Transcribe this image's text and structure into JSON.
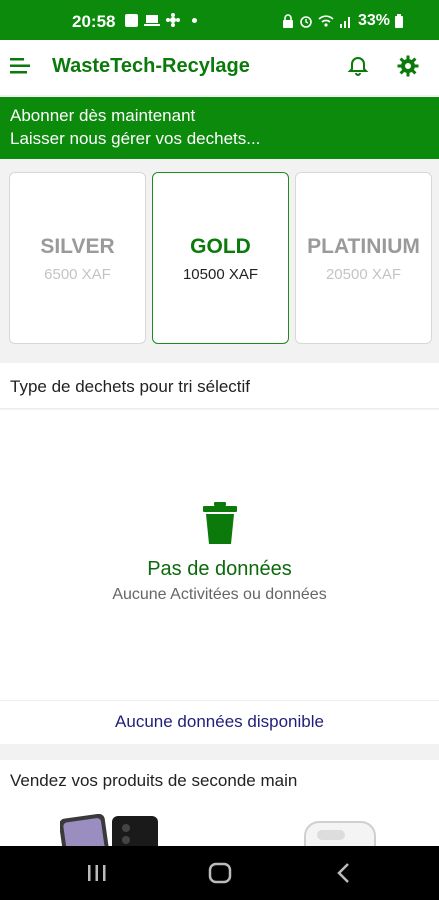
{
  "status_bar": {
    "time": "20:58",
    "battery": "33%"
  },
  "app_bar": {
    "title": "WasteTech-Recylage"
  },
  "banner": {
    "line1": "Abonner dès maintenant",
    "line2": "Laisser nous gérer vos dechets..."
  },
  "plans": [
    {
      "name": "SILVER",
      "price": "6500 XAF",
      "selected": false
    },
    {
      "name": "GOLD",
      "price": "10500 XAF",
      "selected": true
    },
    {
      "name": "PLATINIUM",
      "price": "20500 XAF",
      "selected": false
    }
  ],
  "waste_section": {
    "title": "Type de dechets pour tri sélectif",
    "empty_title": "Pas de données",
    "empty_subtitle": "Aucune Activitées ou données",
    "no_data_label": "Aucune données disponible"
  },
  "secondhand_section": {
    "title": "Vendez vos produits de seconde main"
  },
  "colors": {
    "brand_green": "#0b8a0b",
    "title_green": "#0b7a0b",
    "link_blue": "#1f1f7a"
  },
  "icons": [
    "menu-icon",
    "bell-icon",
    "gear-icon",
    "trash-icon",
    "nav-recent-icon",
    "nav-home-icon",
    "nav-back-icon"
  ]
}
